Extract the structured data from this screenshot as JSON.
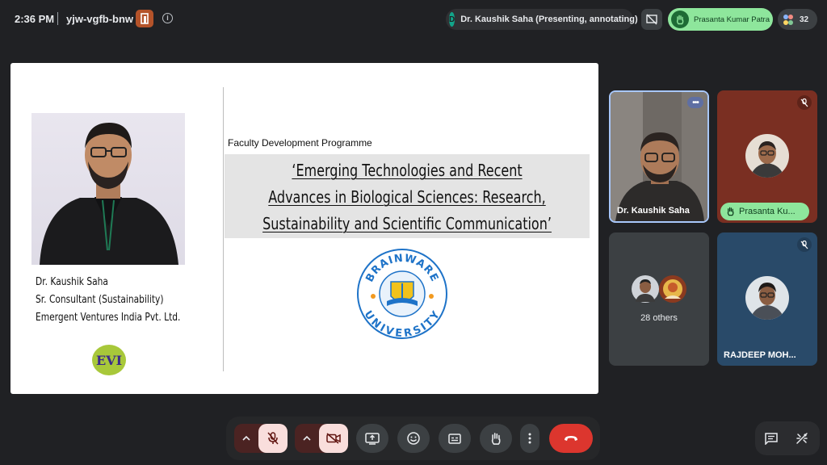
{
  "meeting": {
    "time": "2:36 PM",
    "code": "yjw-vgfb-bnw"
  },
  "presenter_chip": {
    "initial": "D",
    "label": "Dr. Kaushik Saha (Presenting, annotating)",
    "avatar_color": "#12a58a"
  },
  "raised_hand_chip": {
    "label": "Prasanta Kumar Patra",
    "color": "#8ee69c"
  },
  "participants_count": "32",
  "slide": {
    "speaker_name": "Dr. Kaushik Saha",
    "speaker_role": "Sr. Consultant (Sustainability)",
    "speaker_company": "Emergent Ventures India Pvt. Ltd.",
    "evi_logo_text": "EVI",
    "programme": "Faculty Development Programme",
    "title_lines": [
      "‘Emerging Technologies and Recent",
      "Advances in Biological Sciences: Research,",
      "Sustainability and Scientific Communication’"
    ],
    "logo_top_text": "BRAINWARE",
    "logo_bottom_text": "UNIVERSITY"
  },
  "tiles": {
    "kaushik": {
      "name": "Dr. Kaushik Saha"
    },
    "prasanta": {
      "name": "Prasanta Ku..."
    },
    "others": {
      "label": "28 others"
    },
    "rajdeep": {
      "name": "RAJDEEP MOH..."
    }
  },
  "toolbar": {
    "mic": "mic-off",
    "camera": "camera-off",
    "present": "present-screen",
    "reactions": "emoji",
    "captions": "captions",
    "raise_hand": "raise-hand",
    "more": "more-options",
    "leave": "end-call",
    "leave_color": "#dc362e"
  },
  "side_tools": {
    "chat": "chat",
    "activities": "activities"
  },
  "colors": {
    "background": "#202124",
    "accent_blue": "#a8c7fa",
    "muted_red": "#f9dedc"
  }
}
